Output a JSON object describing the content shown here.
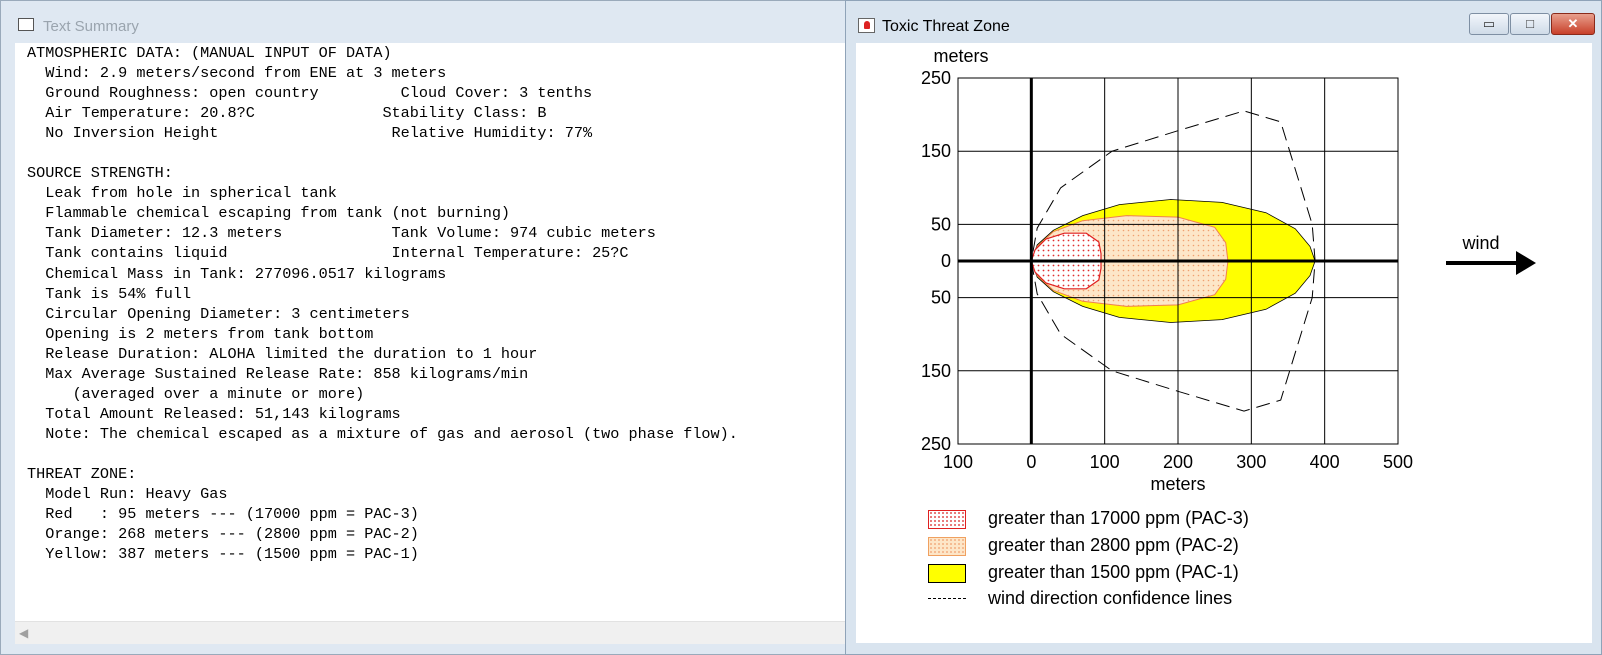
{
  "text_window": {
    "title": "Text Summary",
    "lines": [
      "ATMOSPHERIC DATA: (MANUAL INPUT OF DATA)",
      "  Wind: 2.9 meters/second from ENE at 3 meters",
      "  Ground Roughness: open country         Cloud Cover: 3 tenths",
      "  Air Temperature: 20.8?C              Stability Class: B",
      "  No Inversion Height                   Relative Humidity: 77%",
      "",
      "SOURCE STRENGTH:",
      "  Leak from hole in spherical tank",
      "  Flammable chemical escaping from tank (not burning)",
      "  Tank Diameter: 12.3 meters            Tank Volume: 974 cubic meters",
      "  Tank contains liquid                  Internal Temperature: 25?C",
      "  Chemical Mass in Tank: 277096.0517 kilograms",
      "  Tank is 54% full",
      "  Circular Opening Diameter: 3 centimeters",
      "  Opening is 2 meters from tank bottom",
      "  Release Duration: ALOHA limited the duration to 1 hour",
      "  Max Average Sustained Release Rate: 858 kilograms/min",
      "     (averaged over a minute or more)",
      "  Total Amount Released: 51,143 kilograms",
      "  Note: The chemical escaped as a mixture of gas and aerosol (two phase flow).",
      "",
      "THREAT ZONE:",
      "  Model Run: Heavy Gas",
      "  Red   : 95 meters --- (17000 ppm = PAC-3)",
      "  Orange: 268 meters --- (2800 ppm = PAC-2)",
      "  Yellow: 387 meters --- (1500 ppm = PAC-1)"
    ],
    "scroll_left_glyph": "◀"
  },
  "chart_window": {
    "title": "Toxic Threat Zone",
    "btn_min": "▭",
    "btn_max": "□",
    "btn_close": "✕",
    "wind_label": "wind"
  },
  "colors": {
    "red_zone": "#e02020",
    "orange_zone": "#fde6c8",
    "yellow_zone": "#ffff00"
  },
  "chart_data": {
    "type": "area",
    "xlabel": "meters",
    "ylabel": "meters",
    "xlim": [
      -100,
      500
    ],
    "ylim": [
      -250,
      250
    ],
    "x_tick_labels": [
      "100",
      "0",
      "100",
      "200",
      "300",
      "400",
      "500"
    ],
    "y_tick_labels": [
      "250",
      "150",
      "50",
      "0",
      "50",
      "150",
      "250"
    ],
    "x_tick_values": [
      -100,
      0,
      100,
      200,
      300,
      400,
      500
    ],
    "y_tick_values": [
      250,
      150,
      50,
      0,
      -50,
      -150,
      -250
    ],
    "grid": true,
    "series": [
      {
        "name": "greater than 1500 ppm (PAC-1)",
        "color": "#ffff00",
        "outline": [
          [
            0,
            0
          ],
          [
            8,
            -22
          ],
          [
            30,
            -42
          ],
          [
            70,
            -62
          ],
          [
            120,
            -77
          ],
          [
            190,
            -84
          ],
          [
            260,
            -80
          ],
          [
            320,
            -66
          ],
          [
            360,
            -44
          ],
          [
            380,
            -20
          ],
          [
            387,
            0
          ],
          [
            380,
            20
          ],
          [
            360,
            44
          ],
          [
            320,
            66
          ],
          [
            260,
            80
          ],
          [
            190,
            84
          ],
          [
            120,
            77
          ],
          [
            70,
            62
          ],
          [
            30,
            42
          ],
          [
            8,
            22
          ],
          [
            0,
            0
          ]
        ]
      },
      {
        "name": "greater than 2800 ppm (PAC-2)",
        "color": "#fde6c8",
        "outline": [
          [
            0,
            0
          ],
          [
            8,
            -20
          ],
          [
            30,
            -40
          ],
          [
            70,
            -55
          ],
          [
            130,
            -62
          ],
          [
            200,
            -60
          ],
          [
            250,
            -46
          ],
          [
            265,
            -25
          ],
          [
            268,
            0
          ],
          [
            265,
            25
          ],
          [
            250,
            46
          ],
          [
            200,
            60
          ],
          [
            130,
            62
          ],
          [
            70,
            55
          ],
          [
            30,
            40
          ],
          [
            8,
            20
          ],
          [
            0,
            0
          ]
        ]
      },
      {
        "name": "greater than 17000 ppm (PAC-3)",
        "color": "#e02020",
        "outline": [
          [
            0,
            0
          ],
          [
            5,
            -15
          ],
          [
            20,
            -30
          ],
          [
            45,
            -38
          ],
          [
            75,
            -38
          ],
          [
            92,
            -26
          ],
          [
            95,
            -10
          ],
          [
            95,
            10
          ],
          [
            92,
            26
          ],
          [
            75,
            38
          ],
          [
            45,
            38
          ],
          [
            20,
            30
          ],
          [
            5,
            15
          ],
          [
            0,
            0
          ]
        ]
      },
      {
        "name": "wind direction confidence lines",
        "color": "#000000",
        "outline": [
          [
            0,
            0
          ],
          [
            8,
            -45
          ],
          [
            40,
            -100
          ],
          [
            110,
            -150
          ],
          [
            200,
            -178
          ],
          [
            290,
            -205
          ],
          [
            340,
            -190
          ],
          [
            383,
            -50
          ],
          [
            387,
            0
          ],
          [
            383,
            50
          ],
          [
            340,
            190
          ],
          [
            290,
            205
          ],
          [
            200,
            178
          ],
          [
            110,
            150
          ],
          [
            40,
            100
          ],
          [
            8,
            45
          ],
          [
            0,
            0
          ]
        ]
      }
    ],
    "legend": [
      {
        "label": "greater than 17000 ppm (PAC-3)",
        "style": "red"
      },
      {
        "label": "greater than 2800 ppm (PAC-2)",
        "style": "orange"
      },
      {
        "label": "greater than 1500 ppm (PAC-1)",
        "style": "yellow"
      },
      {
        "label": "wind direction confidence lines",
        "style": "dash"
      }
    ]
  }
}
